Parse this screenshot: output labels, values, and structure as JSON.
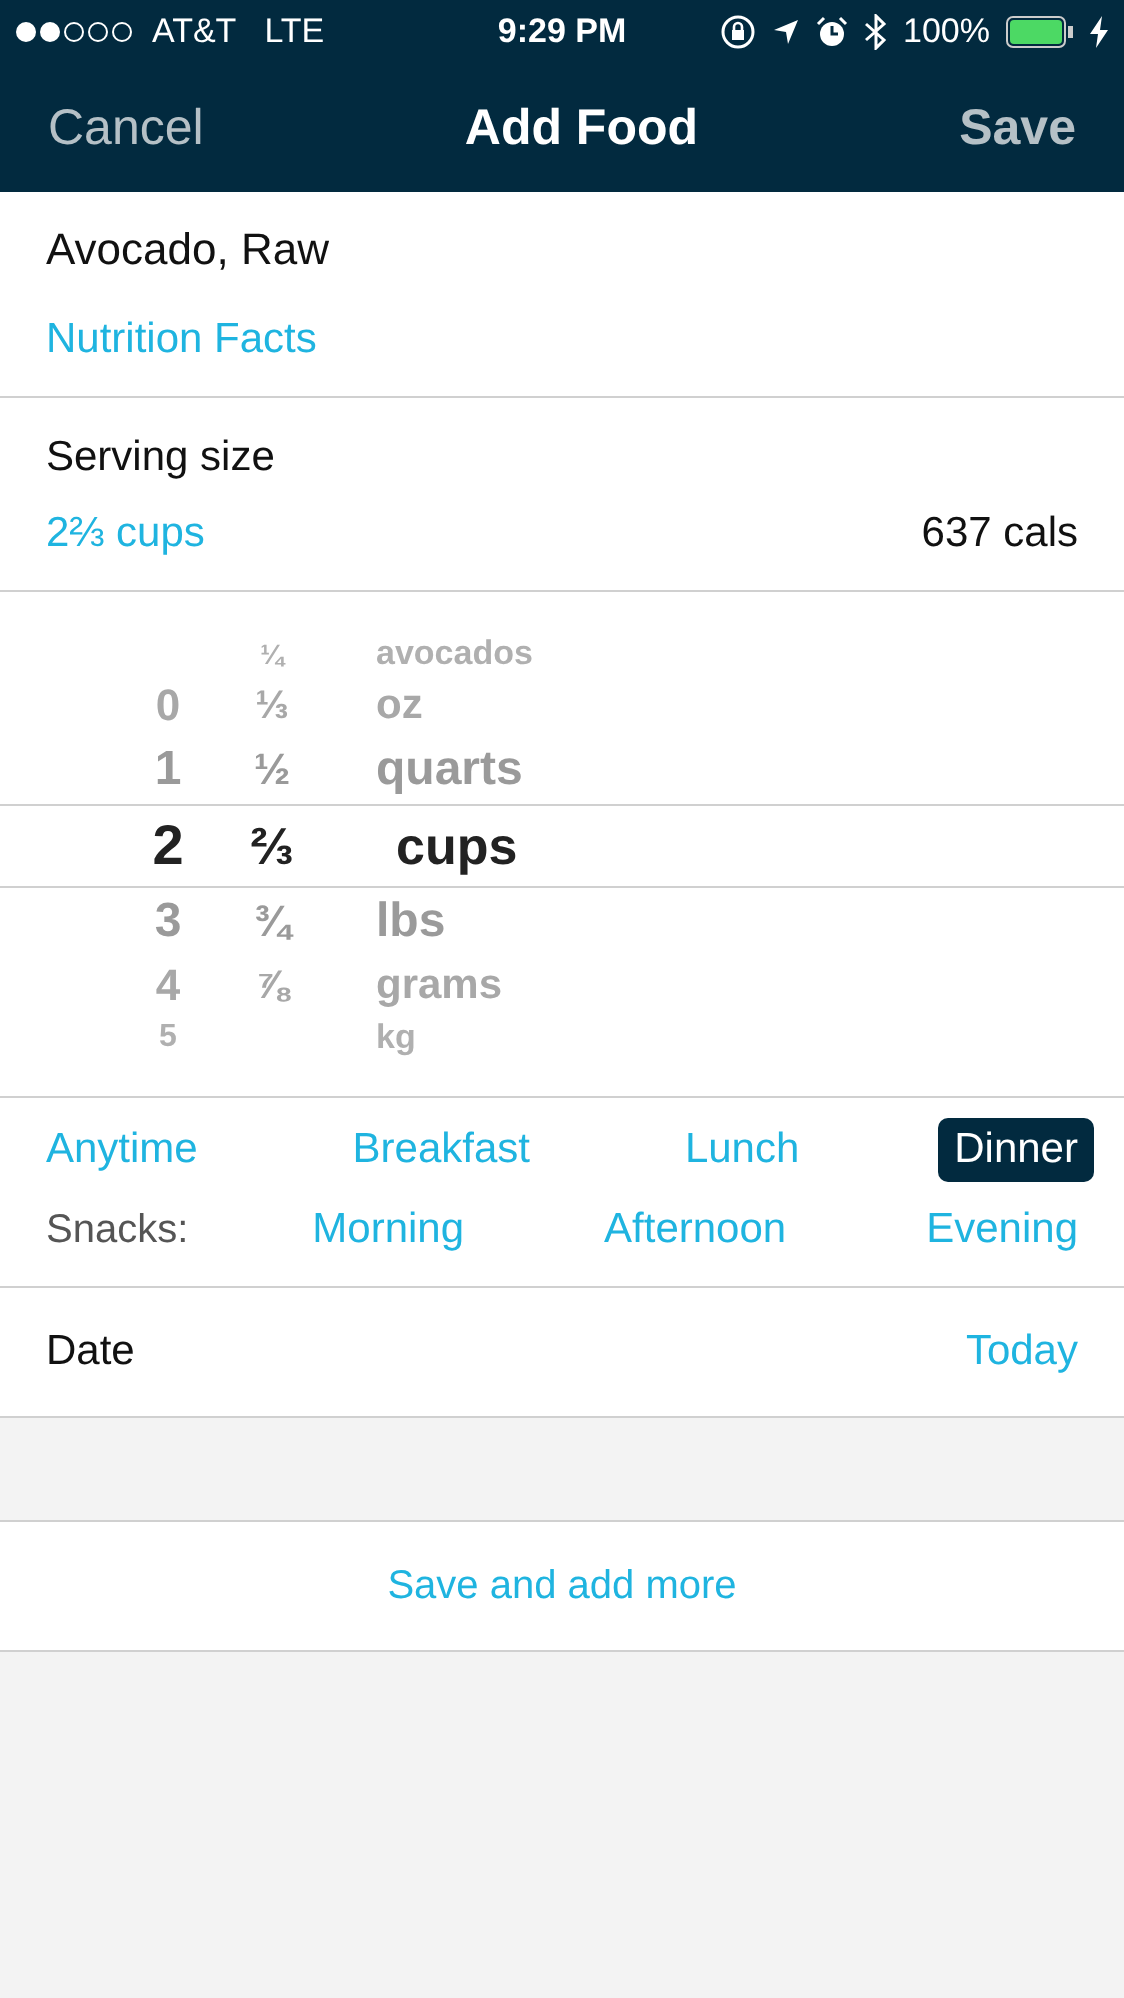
{
  "status_bar": {
    "signal_dots": [
      {
        "filled": true
      },
      {
        "filled": true
      },
      {
        "filled": false
      },
      {
        "filled": false
      },
      {
        "filled": false
      }
    ],
    "carrier": "AT&T",
    "network": "LTE",
    "time": "9:29 PM",
    "battery": "100%"
  },
  "nav": {
    "cancel": "Cancel",
    "title": "Add Food",
    "save": "Save"
  },
  "food": {
    "name": "Avocado, Raw",
    "link": "Nutrition Facts"
  },
  "serving": {
    "label": "Serving size",
    "value": "2⅔ cups",
    "calories": "637 cals"
  },
  "picker": [
    {
      "fraction": "¼",
      "unit": "avocados",
      "selected": false
    },
    {
      "whole": "0",
      "fraction": "⅓",
      "unit": "oz",
      "selected": false
    },
    {
      "whole": "1",
      "fraction": "½",
      "unit": "quarts",
      "selected": false
    },
    {
      "whole": "2",
      "fraction": "⅔",
      "unit": "cups",
      "selected": true
    },
    {
      "whole": "3",
      "fraction": "¾",
      "unit": "lbs",
      "selected": false
    },
    {
      "whole": "4",
      "fraction": "⅞",
      "unit": "grams",
      "selected": false
    },
    {
      "whole": "5",
      "unit": "kg",
      "selected": false
    }
  ],
  "meals": [
    {
      "label": "Anytime",
      "selected": false
    },
    {
      "label": "Breakfast",
      "selected": false
    },
    {
      "label": "Lunch",
      "selected": false
    },
    {
      "label": "Dinner",
      "selected": true
    }
  ],
  "snacks": {
    "label": "Snacks:",
    "items": [
      {
        "label": "Morning",
        "selected": false
      },
      {
        "label": "Afternoon",
        "selected": false
      },
      {
        "label": "Evening",
        "selected": false
      }
    ]
  },
  "date": {
    "label": "Date",
    "value": "Today"
  },
  "save_more": "Save and add more"
}
